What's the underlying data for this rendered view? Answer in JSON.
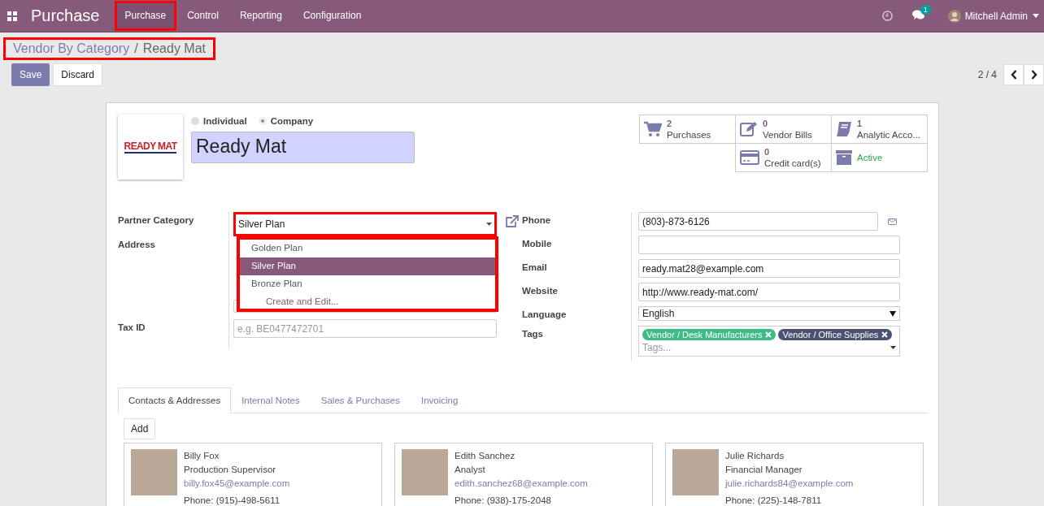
{
  "topbar": {
    "app_title": "Purchase",
    "menu": [
      {
        "label": "Purchase",
        "highlighted": true
      },
      {
        "label": "Control",
        "highlighted": false
      },
      {
        "label": "Reporting",
        "highlighted": false
      },
      {
        "label": "Configuration",
        "highlighted": false
      }
    ],
    "activity_count": "1",
    "user": "Mitchell Admin"
  },
  "breadcrumb": {
    "items": [
      "Vendor By Category",
      "Ready Mat"
    ],
    "separator": "/",
    "highlighted": true
  },
  "buttons": [
    {
      "label": "Save",
      "kind": "primary"
    },
    {
      "label": "Discard",
      "kind": "secondary"
    }
  ],
  "pager": "2 / 4",
  "form": {
    "logo_text": "READY MAT",
    "company_type": [
      {
        "label": "Individual",
        "selected": false
      },
      {
        "label": "Company",
        "selected": true
      }
    ],
    "name": "Ready Mat",
    "smart_buttons": [
      {
        "kind": "cart",
        "count": "2",
        "label": "Purchases"
      },
      {
        "kind": "edit",
        "count": "0",
        "label": "Vendor Bills"
      },
      {
        "kind": "book",
        "count": "1",
        "label": "Analytic Acco..."
      },
      {
        "kind": "card",
        "count": "0",
        "label": "Credit card(s)"
      },
      {
        "kind": "archive",
        "label": "Active"
      }
    ],
    "left_fields": [
      {
        "label": "Partner Category",
        "kind": "select",
        "value": "Silver Plan",
        "highlighted": true
      },
      {
        "label": "Address",
        "kind": "address"
      },
      {
        "label": "Tax ID",
        "kind": "input",
        "placeholder": "e.g. BE0477472701"
      }
    ],
    "dropdown": {
      "options": [
        {
          "label": "Golden Plan",
          "selected": false
        },
        {
          "label": "Silver Plan",
          "selected": true
        },
        {
          "label": "Bronze Plan",
          "selected": false
        }
      ],
      "create_label": "Create and Edit...",
      "highlighted": true
    },
    "right_fields": [
      {
        "label": "Phone",
        "kind": "phone",
        "value": "(803)-873-6126"
      },
      {
        "label": "Mobile",
        "kind": "input"
      },
      {
        "label": "Email",
        "kind": "input",
        "value": "ready.mat28@example.com"
      },
      {
        "label": "Website",
        "kind": "input",
        "value": "http://www.ready-mat.com/"
      },
      {
        "label": "Language",
        "kind": "select",
        "value": "English"
      },
      {
        "label": "Tags",
        "kind": "tags",
        "placeholder": "Tags...",
        "tags": [
          {
            "label": "Vendor / Desk Manufacturers",
            "color": "#3dbd86"
          },
          {
            "label": "Vendor / Office Supplies",
            "color": "#4a5273"
          }
        ]
      }
    ]
  },
  "tabs": [
    {
      "label": "Contacts & Addresses",
      "selected": true
    },
    {
      "label": "Internal Notes",
      "selected": false
    },
    {
      "label": "Sales & Purchases",
      "selected": false
    },
    {
      "label": "Invoicing",
      "selected": false
    }
  ],
  "add_button": "Add",
  "contacts": [
    {
      "name": "Billy Fox",
      "role": "Production Supervisor",
      "email": "billy.fox45@example.com",
      "phone": "Phone: (915)-498-5611"
    },
    {
      "name": "Edith Sanchez",
      "role": "Analyst",
      "email": "edith.sanchez68@example.com",
      "phone": "Phone: (938)-175-2048"
    },
    {
      "name": "Julie Richards",
      "role": "Financial Manager",
      "email": "julie.richards84@example.com",
      "phone": "Phone: (225)-148-7811"
    }
  ]
}
